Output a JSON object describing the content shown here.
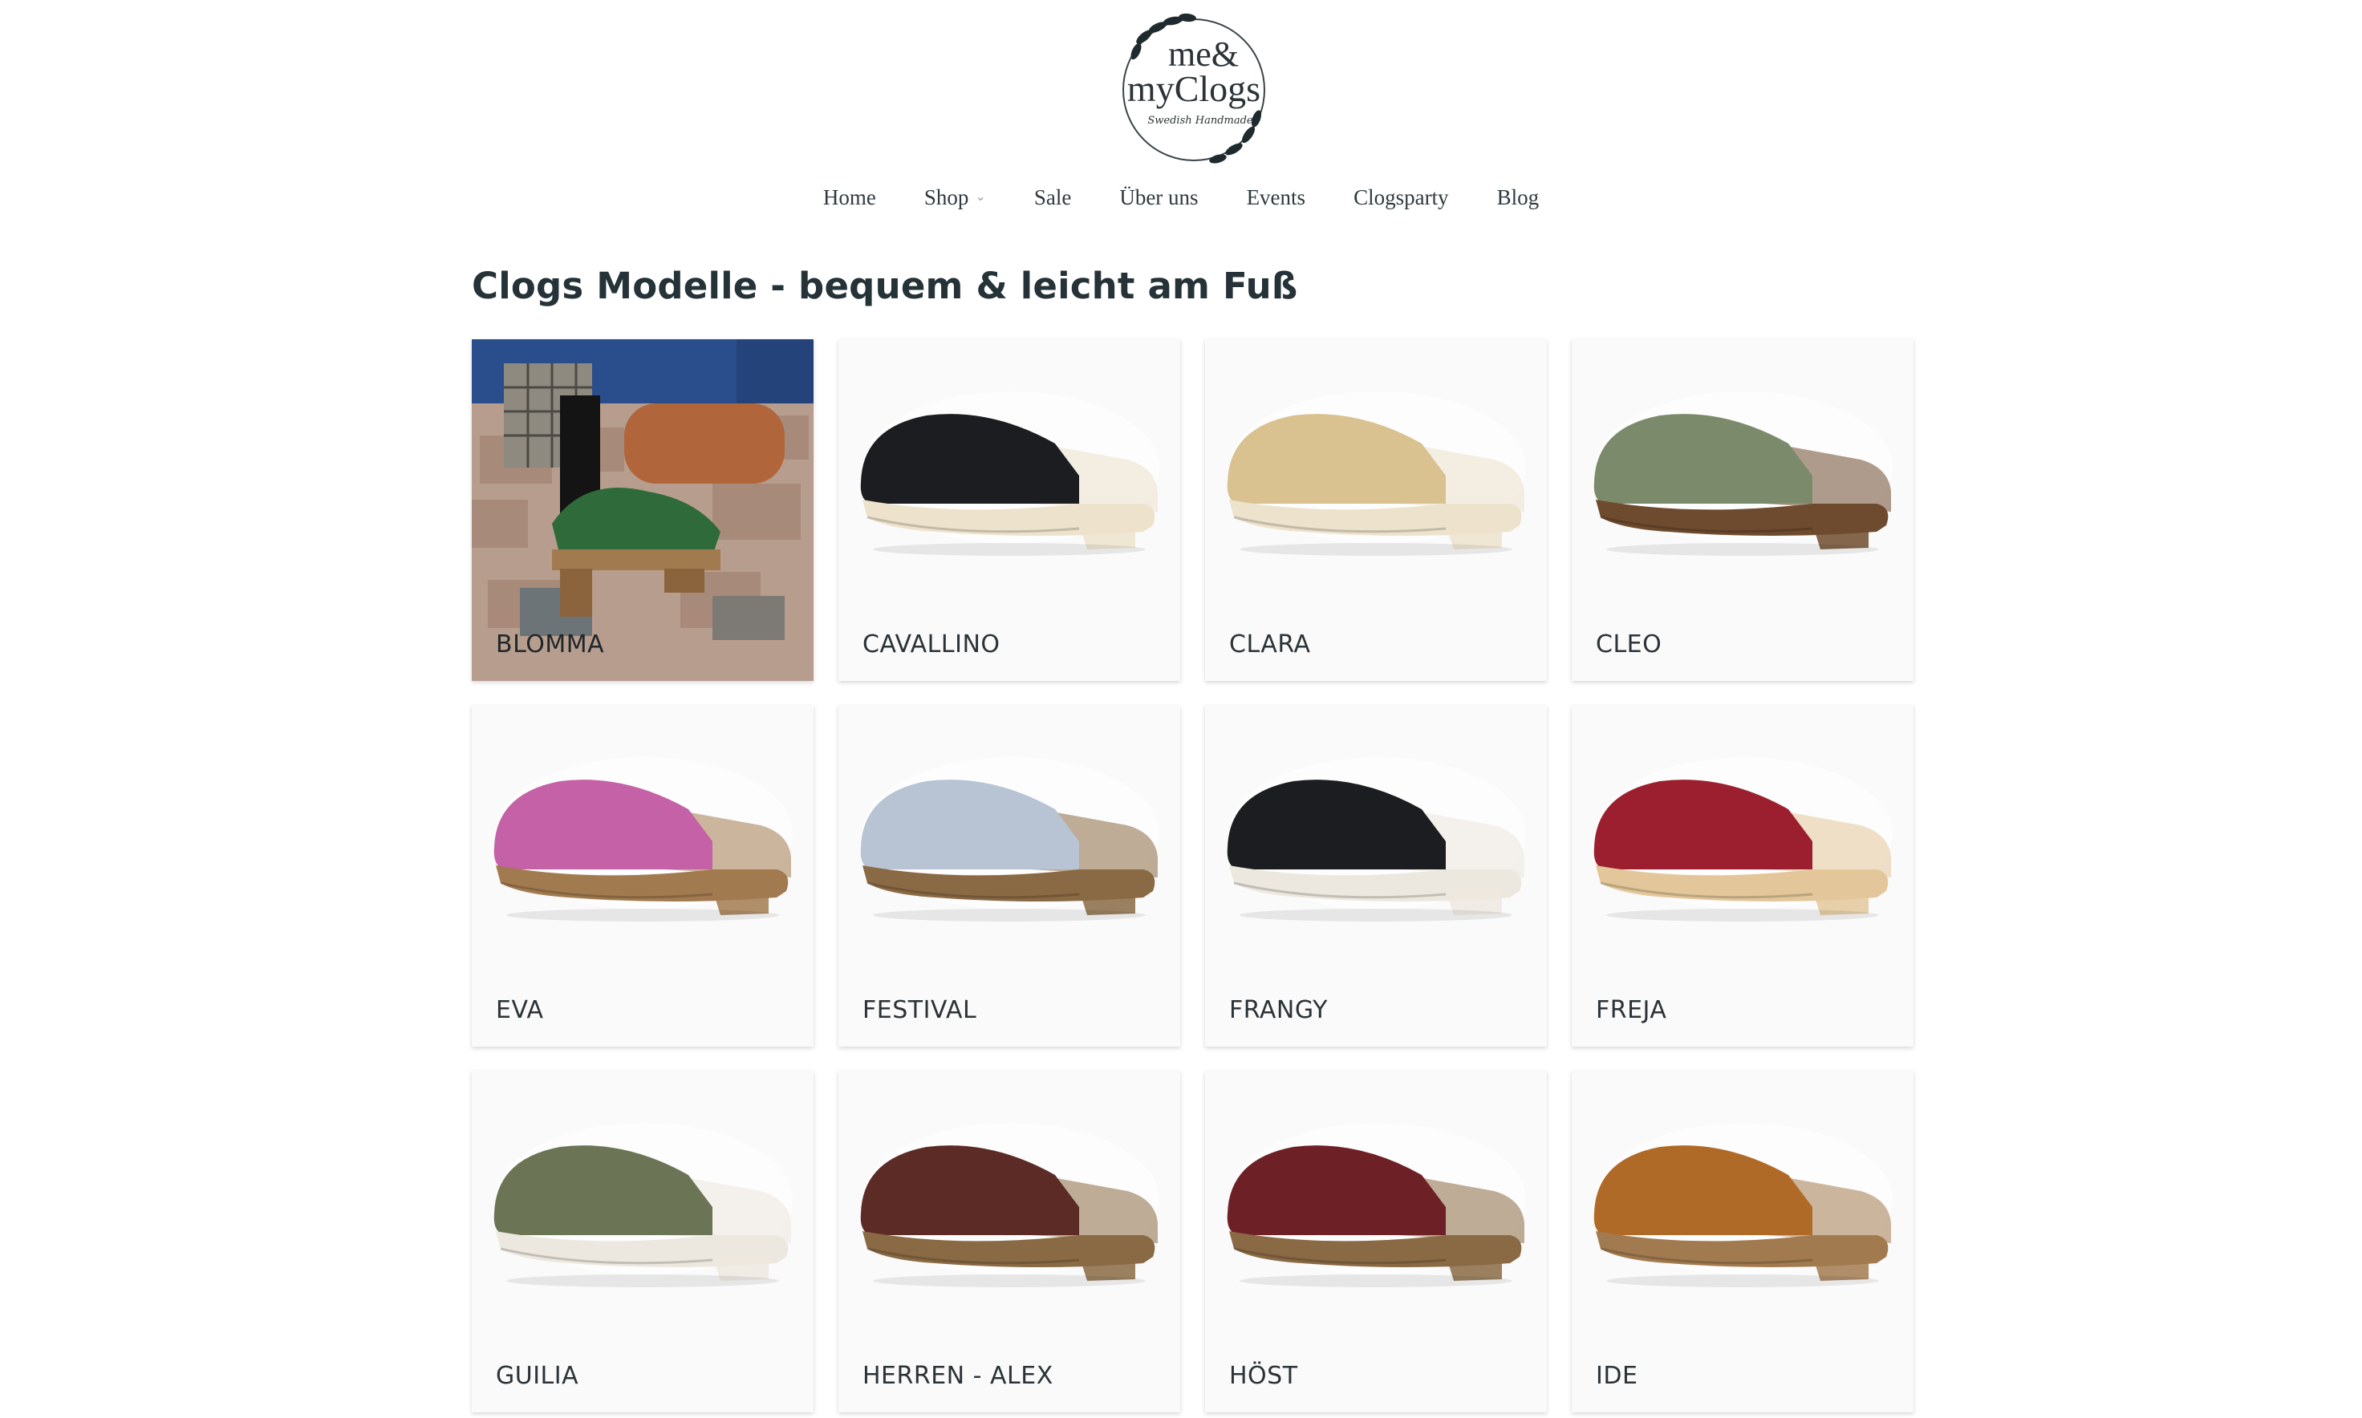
{
  "brand": {
    "logo_line1": "me&",
    "logo_line2": "myClogs",
    "logo_tagline": "Swedish Handmade"
  },
  "nav": {
    "items": [
      {
        "label": "Home"
      },
      {
        "label": "Shop",
        "icon": "chevron-down-icon"
      },
      {
        "label": "Sale"
      },
      {
        "label": "Über uns"
      },
      {
        "label": "Events"
      },
      {
        "label": "Clogsparty"
      },
      {
        "label": "Blog"
      }
    ]
  },
  "main": {
    "title": "Clogs Modelle - bequem & leicht am Fuß",
    "products": [
      {
        "name": "BLOMMA",
        "upper": "#2f6b3a",
        "sole": "#a27a4f"
      },
      {
        "name": "CAVALLINO",
        "upper": "#1c1d20",
        "sole": "#ede2cc"
      },
      {
        "name": "CLARA",
        "upper": "#d9c190",
        "sole": "#ede2cc"
      },
      {
        "name": "CLEO",
        "upper": "#7c8a6c",
        "sole": "#6e4b2e"
      },
      {
        "name": "EVA",
        "upper": "#c561a6",
        "sole": "#a27a4f"
      },
      {
        "name": "FESTIVAL",
        "upper": "#b8c3d3",
        "sole": "#8a6a44"
      },
      {
        "name": "FRANGY",
        "upper": "#1c1d20",
        "sole": "#ede8df"
      },
      {
        "name": "FREJA",
        "upper": "#9b1f2e",
        "sole": "#e3c79a"
      },
      {
        "name": "GUILIA",
        "upper": "#6b7556",
        "sole": "#ede8df"
      },
      {
        "name": "HERREN - ALEX",
        "upper": "#5c2b26",
        "sole": "#8a6a44"
      },
      {
        "name": "HÖST",
        "upper": "#6e2027",
        "sole": "#8a6a44"
      },
      {
        "name": "IDE",
        "upper": "#b06a28",
        "sole": "#a27a4f"
      }
    ]
  }
}
